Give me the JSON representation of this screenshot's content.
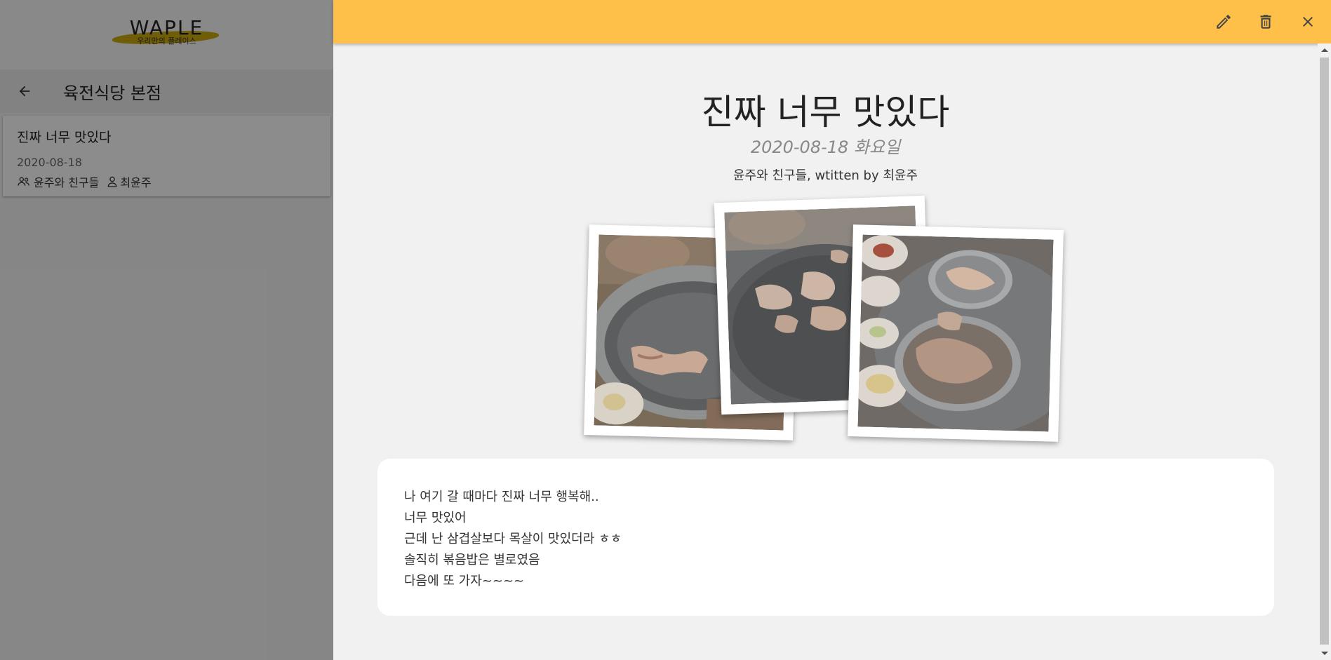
{
  "logo": {
    "title": "WAPLE",
    "subtitle": "우리만의 플레이스"
  },
  "store": {
    "name": "육전식당 본점"
  },
  "post_card": {
    "title": "진짜 너무 맛있다",
    "date": "2020-08-18",
    "group": "윤주와 친구들",
    "author": "최윤주"
  },
  "post": {
    "title": "진짜 너무 맛있다",
    "date": "2020-08-18 화요일",
    "byline": "윤주와 친구들, wtitten by 최윤주",
    "lines": [
      "나 여기 갈 때마다 진짜 너무 행복해..",
      "너무 맛있어",
      "근데 난 삼겹살보다 목살이 맛있더라 ㅎㅎ",
      "솔직히 볶음밥은 별로였음",
      "다음에 또 가자~~~~"
    ]
  },
  "colors": {
    "accent_bar": "#ffc04a",
    "logo_swoosh": "#c9a400"
  },
  "icons": [
    "back-arrow-icon",
    "group-icon",
    "person-icon",
    "edit-icon",
    "delete-icon",
    "close-icon"
  ]
}
